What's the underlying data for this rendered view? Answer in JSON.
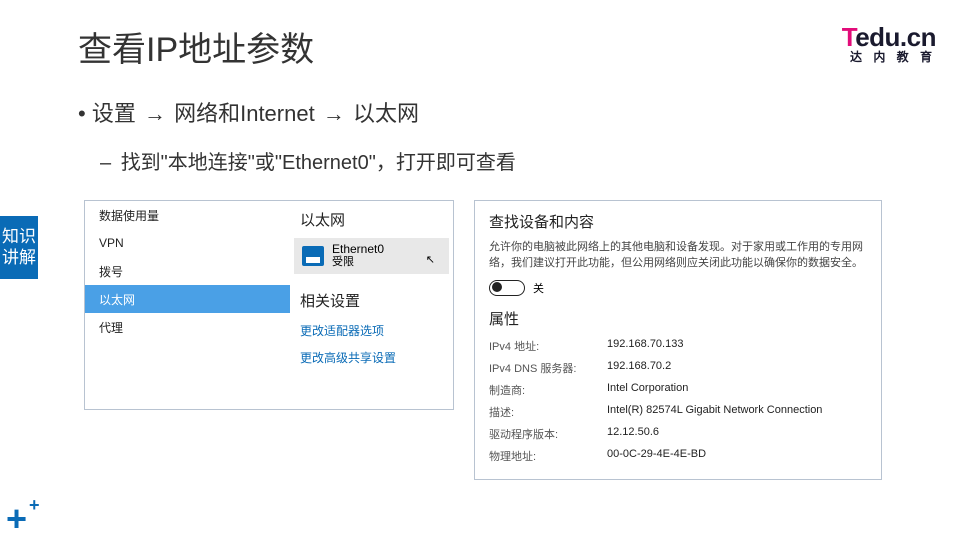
{
  "title": "查看IP地址参数",
  "logo": {
    "t": "T",
    "rest": "edu.cn",
    "sub": "达 内 教 育"
  },
  "bullet1": {
    "p1": "设置",
    "arrow": "→",
    "p2": "网络和Internet",
    "p3": "以太网"
  },
  "bullet2": "找到\"本地连接\"或\"Ethernet0\"，打开即可查看",
  "side_tag": "知识讲解",
  "panel_left": {
    "nav": [
      "数据使用量",
      "VPN",
      "拨号",
      "以太网",
      "代理"
    ],
    "active_index": 3,
    "heading_ethernet": "以太网",
    "ethernet_item": {
      "name": "Ethernet0",
      "status": "受限"
    },
    "heading_related": "相关设置",
    "links": [
      "更改适配器选项",
      "更改高级共享设置"
    ]
  },
  "panel_right": {
    "title": "查找设备和内容",
    "desc": "允许你的电脑被此网络上的其他电脑和设备发现。对于家用或工作用的专用网络，我们建议打开此功能，但公用网络则应关闭此功能以确保你的数据安全。",
    "toggle_state": "关",
    "props_heading": "属性",
    "rows": [
      {
        "key": "IPv4 地址:",
        "val": "192.168.70.133"
      },
      {
        "key": "IPv4 DNS 服务器:",
        "val": "192.168.70.2"
      },
      {
        "key": "制造商:",
        "val": "Intel Corporation"
      },
      {
        "key": "描述:",
        "val": "Intel(R) 82574L Gigabit Network Connection"
      },
      {
        "key": "驱动程序版本:",
        "val": "12.12.50.6"
      },
      {
        "key": "物理地址:",
        "val": "00-0C-29-4E-4E-BD"
      }
    ]
  }
}
